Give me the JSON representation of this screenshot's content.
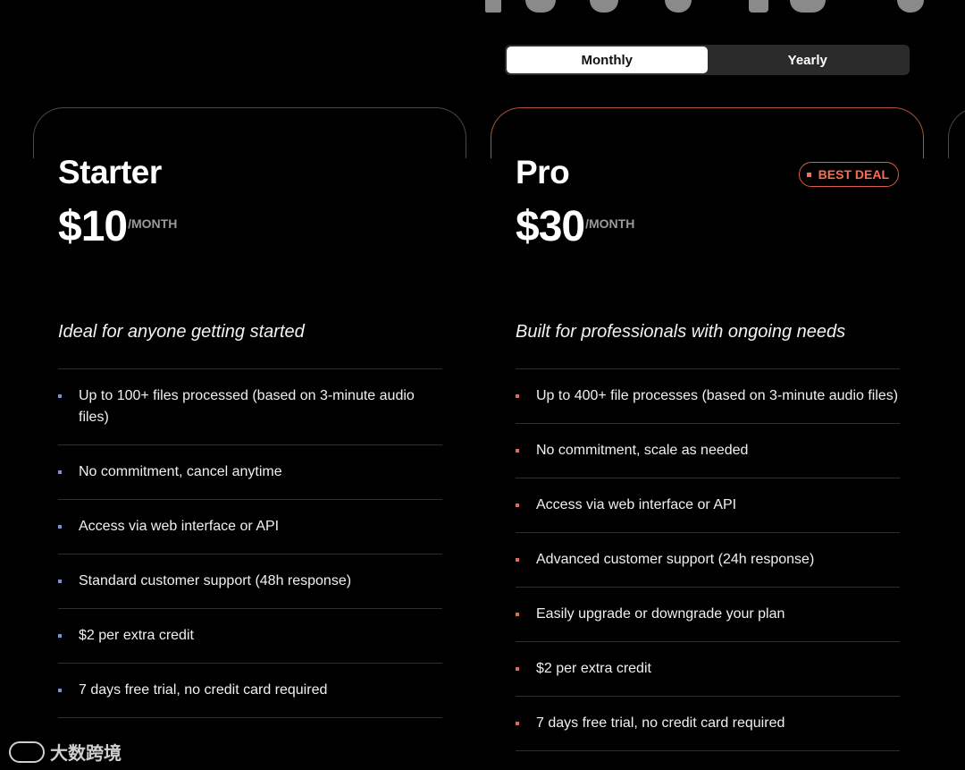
{
  "toggle": {
    "monthly_label": "Monthly",
    "yearly_label": "Yearly"
  },
  "plans": [
    {
      "name": "Starter",
      "price": "$10",
      "period": "/MONTH",
      "tagline": "Ideal for anyone getting started",
      "features": [
        "Up to 100+ files processed (based on 3-minute audio files)",
        "No commitment, cancel anytime",
        "Access via web interface or API",
        "Standard customer support (48h response)",
        "$2 per extra credit",
        "7 days free trial, no credit card required"
      ]
    },
    {
      "name": "Pro",
      "price": "$30",
      "period": "/MONTH",
      "badge": "BEST DEAL",
      "tagline": "Built for professionals with ongoing needs",
      "features": [
        "Up to 400+ file processes (based on 3-minute audio files)",
        "No commitment, scale as needed",
        "Access via web interface or API",
        "Advanced customer support (24h response)",
        "Easily upgrade or downgrade your plan",
        "$2 per extra credit",
        "7 days free trial, no credit card required"
      ]
    }
  ],
  "watermark": {
    "text": "大数跨境"
  },
  "colors": {
    "accent_pro": "#e05a43",
    "bullet_starter": "#7d8fd8",
    "background": "#000000"
  }
}
